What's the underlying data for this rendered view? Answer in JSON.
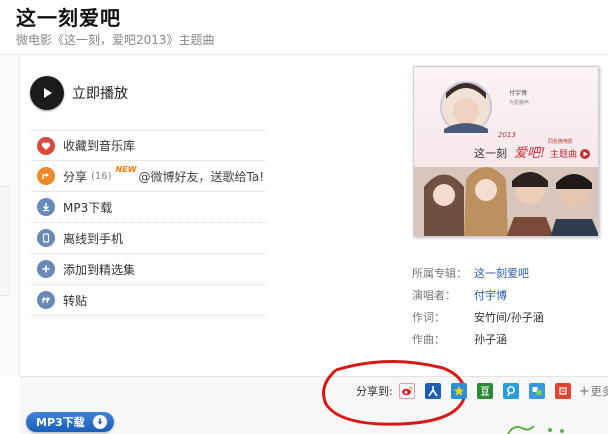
{
  "header": {
    "title": "这一刻爱吧",
    "subtitle": "微电影《这一刻，爱吧2013》主题曲"
  },
  "play": {
    "label": "立即播放"
  },
  "actions": {
    "favorite": "收藏到音乐库",
    "share": "分享",
    "share_count": "(16)",
    "new_badge": "NEW",
    "share_promo": "@微博好友，送歌给Ta!",
    "mp3_download": "MP3下载",
    "offline": "离线到手机",
    "add_playlist": "添加到精选集",
    "repost": "转贴"
  },
  "info": {
    "album_key": "所属专辑：",
    "album_value": "这一刻爱吧",
    "singer_key": "演唱者：",
    "singer_value": "付宇博",
    "lyricist_key": "作词：",
    "lyricist_value": "安竹间/孙子涵",
    "composer_key": "作曲：",
    "composer_value": "孙子涵"
  },
  "cover": {
    "singer_name": "付宇博",
    "singer_sub": "为爱献声",
    "year": "2013",
    "main_text_1": "这一刻",
    "main_text_2": "爱吧!",
    "sub_text": "主题曲",
    "small_text": "同名微电影"
  },
  "share": {
    "label": "分享到:",
    "more": "更多",
    "icons": [
      "weibo-icon",
      "renren-icon",
      "qzone-icon",
      "douban-icon",
      "tqq-icon",
      "kaixin-icon",
      "netease-icon"
    ]
  },
  "bottom": {
    "mp3_button": "MP3下载"
  },
  "colors": {
    "link": "#2a5db0",
    "favorite_icon": "#d94a3d",
    "share_icon": "#ee8a28",
    "action_icon": "#6b89b7",
    "annotation_red": "#d81818",
    "mp3_button": "#2a6cc8"
  }
}
